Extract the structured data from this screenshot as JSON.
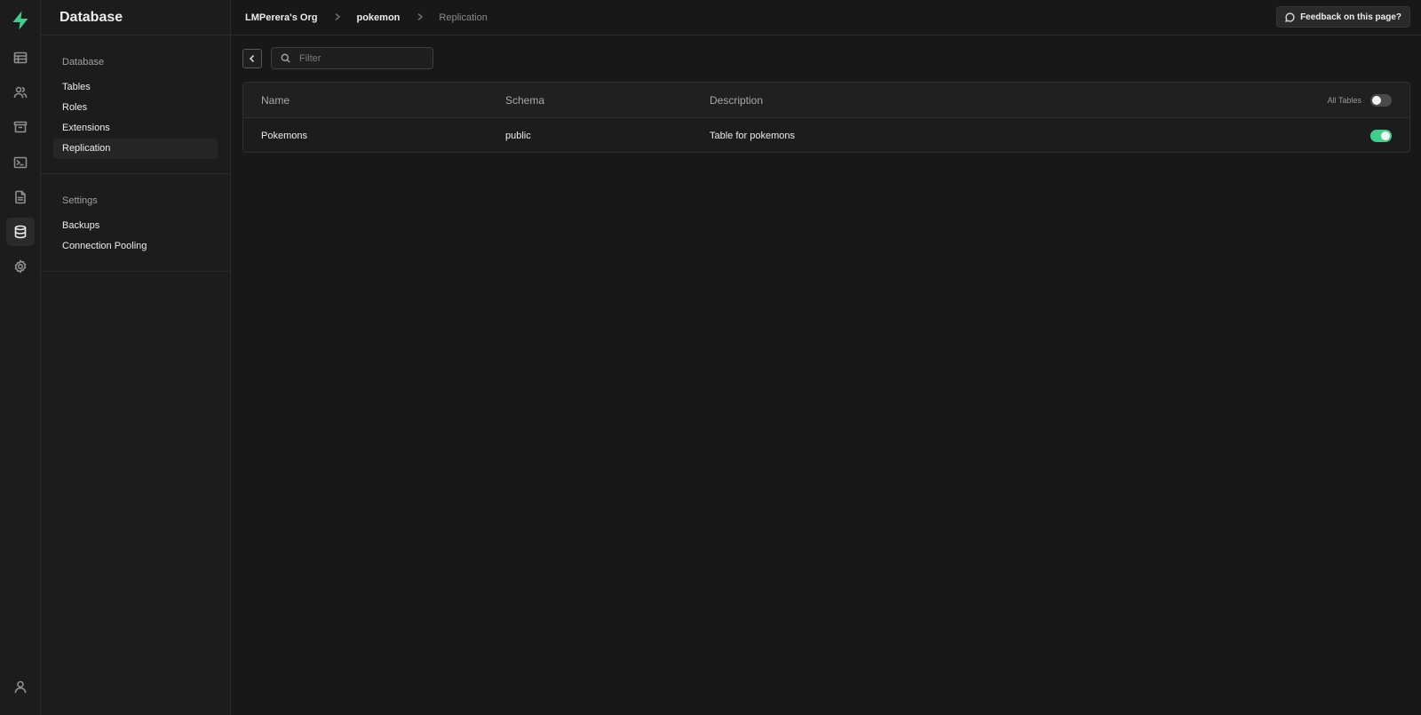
{
  "menu": {
    "title": "Database",
    "sections": [
      {
        "title": "Database",
        "items": [
          {
            "label": "Tables"
          },
          {
            "label": "Roles"
          },
          {
            "label": "Extensions"
          },
          {
            "label": "Replication"
          }
        ]
      },
      {
        "title": "Settings",
        "items": [
          {
            "label": "Backups"
          },
          {
            "label": "Connection Pooling"
          }
        ]
      }
    ]
  },
  "rail": {
    "icons": [
      "table-editor-icon",
      "users-icon",
      "storage-icon",
      "sql-terminal-icon",
      "document-icon",
      "database-icon",
      "settings-icon"
    ],
    "active": "database-icon",
    "bottom_icon": "user-profile-icon",
    "brand_color": "#3ecf8e"
  },
  "breadcrumb": {
    "org": "LMPerera's Org",
    "project": "pokemon",
    "page": "Replication"
  },
  "feedback": {
    "label": "Feedback on this page?"
  },
  "filter": {
    "placeholder": "Filter",
    "value": ""
  },
  "table": {
    "columns": [
      "Name",
      "Schema",
      "Description"
    ],
    "all_tables_label": "All Tables",
    "all_tables_enabled": false,
    "rows": [
      {
        "name": "Pokemons",
        "schema": "public",
        "description": "Table for pokemons",
        "enabled": true
      }
    ]
  }
}
